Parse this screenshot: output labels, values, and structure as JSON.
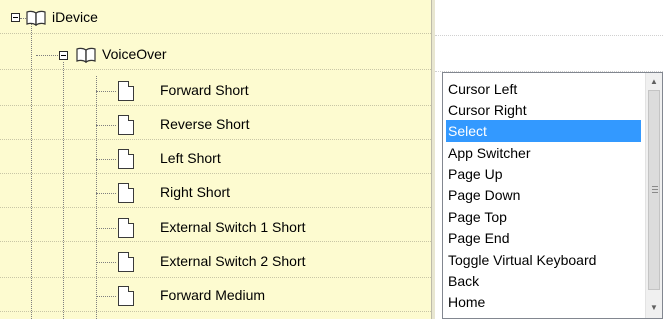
{
  "tree": {
    "root": {
      "label": "iDevice",
      "expander": "minus",
      "icon": "book-icon"
    },
    "child": {
      "label": "VoiceOver",
      "expander": "minus",
      "icon": "book-icon"
    },
    "leaves": [
      "Forward Short",
      "Reverse Short",
      "Left Short",
      "Right Short",
      "External Switch 1 Short",
      "External Switch 2 Short",
      "Forward Medium"
    ]
  },
  "dropdown": {
    "items": [
      "Cursor Left",
      "Cursor Right",
      "Select",
      "App Switcher",
      "Page Up",
      "Page Down",
      "Page Top",
      "Page End",
      "Toggle Virtual Keyboard",
      "Back",
      "Home"
    ],
    "selected": "Select",
    "selection_color": "#3399ff"
  },
  "colors": {
    "tree_background": "#fdfbd0",
    "list_background": "#ffffff"
  }
}
